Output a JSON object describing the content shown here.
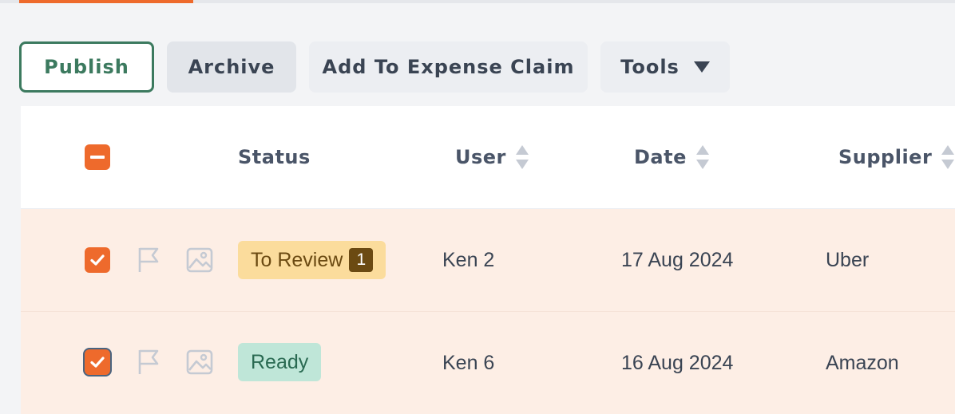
{
  "toolbar": {
    "publish": "Publish",
    "archive": "Archive",
    "expense": "Add To Expense Claim",
    "tools": "Tools"
  },
  "columns": {
    "status": "Status",
    "user": "User",
    "date": "Date",
    "supplier": "Supplier"
  },
  "rows": [
    {
      "status": "To Review",
      "count": "1",
      "user": "Ken 2",
      "date": "17 Aug 2024",
      "supplier": "Uber",
      "checked": true
    },
    {
      "status": "Ready",
      "count": "",
      "user": "Ken 6",
      "date": "16 Aug 2024",
      "supplier": "Amazon",
      "checked": true
    }
  ],
  "icons": [
    "chevron-down-icon",
    "sort-icon",
    "check-icon",
    "minus-icon",
    "flag-icon",
    "image-icon"
  ],
  "colors": {
    "accent": "#ee6a2c",
    "publish": "#3c7a5f",
    "review_badge": "#fbdc9c",
    "ready_badge": "#bfe6d8",
    "row_selected": "#fdeee5"
  }
}
